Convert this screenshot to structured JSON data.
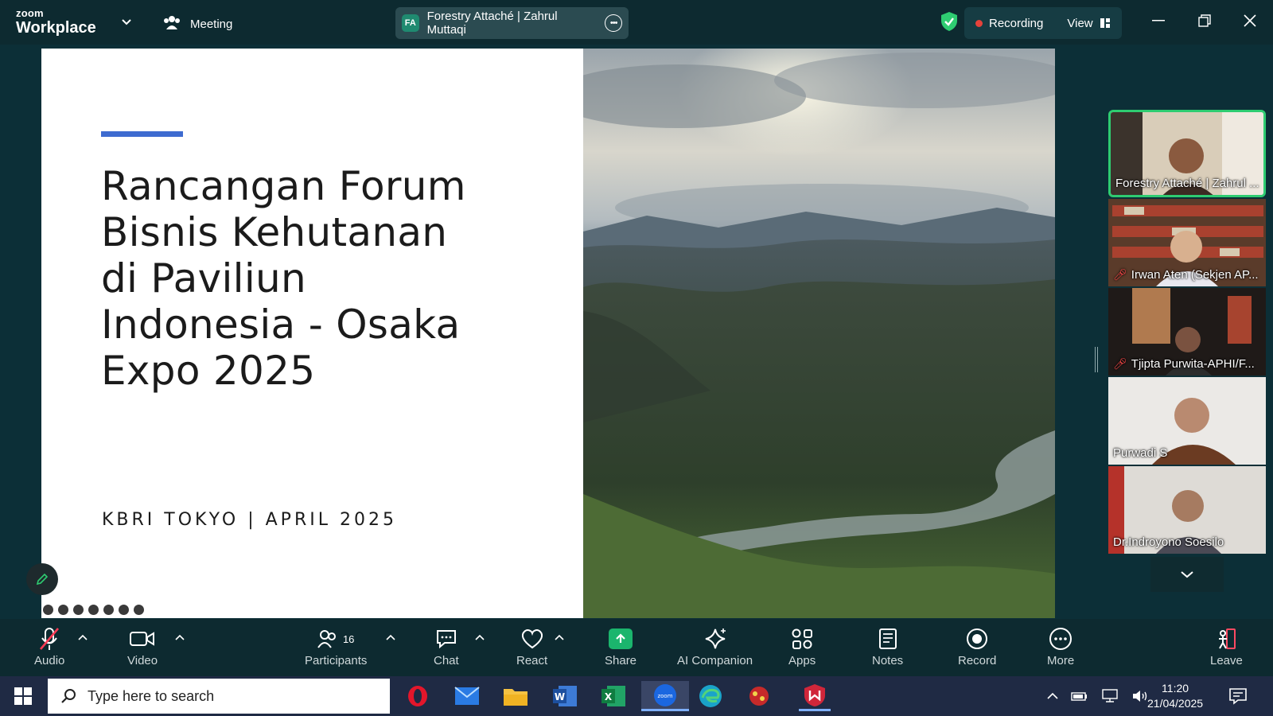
{
  "app": {
    "brand_small": "zoom",
    "brand_large": "Workplace",
    "meeting_label": "Meeting"
  },
  "meeting": {
    "badge": "FA",
    "title": "Forestry Attaché | Zahrul Muttaqi"
  },
  "status": {
    "recording_label": "Recording",
    "view_label": "View"
  },
  "slide": {
    "title_lines": [
      "Rancangan Forum",
      "Bisnis Kehutanan",
      "di Paviliun",
      "Indonesia - Osaka",
      "Expo 2025"
    ],
    "subtitle": "KBRI TOKYO | APRIL 2025",
    "accent_color": "#3e6bd0"
  },
  "participants": [
    {
      "name": "Forestry Attaché | Zahrul ...",
      "muted": false,
      "active": true
    },
    {
      "name": "Irwan Aten (Sekjen AP...",
      "muted": true,
      "active": false
    },
    {
      "name": "Tjipta Purwita-APHI/F...",
      "muted": true,
      "active": false
    },
    {
      "name": "Purwadi S",
      "muted": false,
      "active": false
    },
    {
      "name": "Dr.Indroyono Soesilo",
      "muted": false,
      "active": false
    }
  ],
  "toolbar": {
    "audio": "Audio",
    "video": "Video",
    "participants": "Participants",
    "participants_count": "16",
    "chat": "Chat",
    "react": "React",
    "share": "Share",
    "ai_companion": "AI Companion",
    "apps": "Apps",
    "notes": "Notes",
    "record": "Record",
    "more": "More",
    "leave": "Leave"
  },
  "taskbar": {
    "search_placeholder": "Type here to search",
    "time": "11:20",
    "date": "21/04/2025"
  },
  "colors": {
    "active_speaker": "#2ecc71",
    "share_green": "#1bb56d",
    "recording_dot": "#e5423a",
    "mute_red": "#ff4a4a"
  }
}
